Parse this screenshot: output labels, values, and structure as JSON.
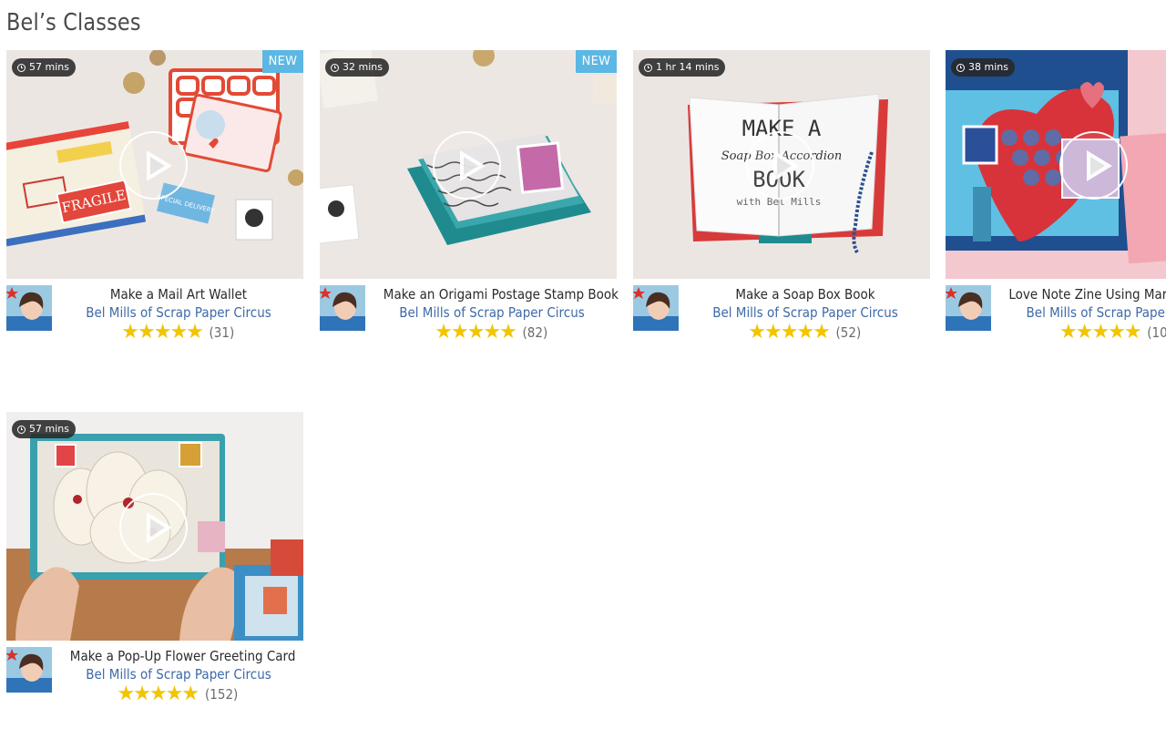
{
  "page": {
    "title": "Bel’s Classes"
  },
  "icons": {
    "clock": "clock-icon",
    "play": "play-icon",
    "star": "star-icon"
  },
  "colors": {
    "badge": "#5cb7e3",
    "author_link": "#3e6aa8",
    "stars": "#f2c500"
  },
  "classes": [
    {
      "duration": "57 mins",
      "badge": "NEW",
      "title": "Make a Mail Art Wallet",
      "author": "Bel Mills of Scrap Paper Circus",
      "stars": "★★★★★",
      "rating": 5,
      "reviews": "(31)"
    },
    {
      "duration": "32 mins",
      "badge": "NEW",
      "title": "Make an Origami Postage Stamp Book",
      "author": "Bel Mills of Scrap Paper Circus",
      "stars": "★★★★★",
      "rating": 5,
      "reviews": "(82)"
    },
    {
      "duration": "1 hr 14 mins",
      "badge": "",
      "title": "Make a Soap Box Book",
      "author": "Bel Mills of Scrap Paper Circus",
      "stars": "★★★★★",
      "rating": 5,
      "reviews": "(52)"
    },
    {
      "duration": "38 mins",
      "badge": "",
      "title": "Love Note Zine Using Marb",
      "author": "Bel Mills of Scrap Pape",
      "stars": "★★★★★",
      "rating": 5,
      "reviews": "(10"
    },
    {
      "duration": "57 mins",
      "badge": "",
      "title": "Make a Pop-Up Flower Greeting Card",
      "author": "Bel Mills of Scrap Paper Circus",
      "stars": "★★★★★",
      "rating": 5,
      "reviews": "(152)"
    }
  ],
  "thumb_text": {
    "wallet_label": "FRAGILE",
    "wallet_sticker": "SPECIAL DELIVERY",
    "book_title_line1": "MAKE A",
    "book_title_line2": "Soap Box Accordion",
    "book_title_line3": "BOOK",
    "book_title_line4": "with Bel Mills"
  }
}
